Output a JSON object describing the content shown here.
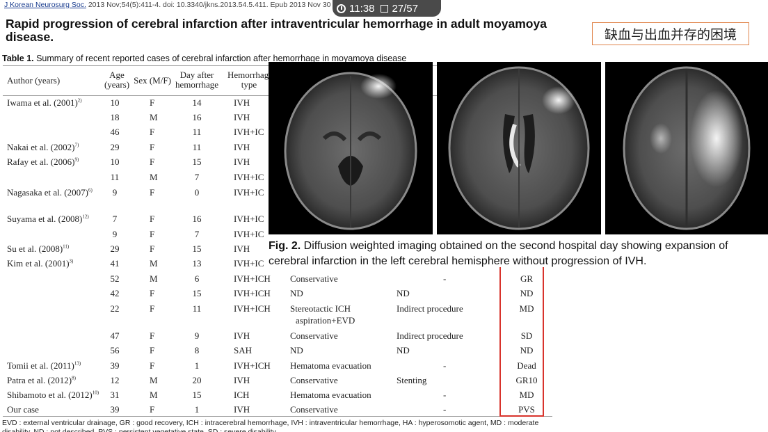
{
  "citation": {
    "journal": "J Korean Neurosurg Soc.",
    "rest": " 2013 Nov;54(5):411-4. doi: 10.3340/jkns.2013.54.5.411. Epub 2013 Nov 30"
  },
  "overlay": {
    "time": "11:38",
    "page": "27/57"
  },
  "title": "Rapid progression of cerebral infarction after intraventricular hemorrhage in adult moyamoya disease.",
  "note": "缺血与出血并存的困境",
  "table": {
    "caption_label": "Table 1.",
    "caption_text": " Summary of recent reported cases of cerebral infarction after hemorrhage in moyamoya disease",
    "headers": {
      "author": "Author (years)",
      "age": "Age\n(years)",
      "sex": "Sex (M/F)",
      "day": "Day after\nhemorrhage",
      "hemorrhage": "Hemorrhage\ntype"
    },
    "rows": [
      {
        "author": "Iwama et al. (2001)",
        "ref": "2)",
        "age": "10",
        "sex": "F",
        "day": "14",
        "type": "IVH",
        "treat": "",
        "surg": "",
        "out": ""
      },
      {
        "author": "",
        "ref": "",
        "age": "18",
        "sex": "M",
        "day": "16",
        "type": "IVH",
        "treat": "",
        "surg": "",
        "out": ""
      },
      {
        "author": "",
        "ref": "",
        "age": "46",
        "sex": "F",
        "day": "11",
        "type": "IVH+IC",
        "treat": "",
        "surg": "",
        "out": ""
      },
      {
        "author": "Nakai et al. (2002)",
        "ref": "7)",
        "age": "29",
        "sex": "F",
        "day": "11",
        "type": "IVH",
        "treat": "",
        "surg": "",
        "out": ""
      },
      {
        "author": "Rafay et al. (2006)",
        "ref": "9)",
        "age": "10",
        "sex": "F",
        "day": "15",
        "type": "IVH",
        "treat": "",
        "surg": "",
        "out": ""
      },
      {
        "author": "",
        "ref": "",
        "age": "11",
        "sex": "M",
        "day": "7",
        "type": "IVH+IC",
        "treat": "",
        "surg": "",
        "out": ""
      },
      {
        "author": "Nagasaka et al. (2007)",
        "ref": "6)",
        "age": "9",
        "sex": "F",
        "day": "0",
        "type": "IVH+IC",
        "treat": "",
        "surg": "",
        "out": ""
      },
      {
        "author": "Suyama et al. (2008)",
        "ref": "12)",
        "age": "7",
        "sex": "F",
        "day": "16",
        "type": "IVH+IC",
        "treat": "",
        "surg": "",
        "out": ""
      },
      {
        "author": "",
        "ref": "",
        "age": "9",
        "sex": "F",
        "day": "7",
        "type": "IVH+IC",
        "treat": "",
        "surg": "",
        "out": ""
      },
      {
        "author": "Su et al. (2008)",
        "ref": "11)",
        "age": "29",
        "sex": "F",
        "day": "15",
        "type": "IVH",
        "treat": "",
        "surg": "",
        "out": ""
      },
      {
        "author": "Kim et al. (2001)",
        "ref": "3)",
        "age": "41",
        "sex": "M",
        "day": "13",
        "type": "IVH+IC",
        "treat": "",
        "surg": "",
        "out": ""
      },
      {
        "author": "",
        "ref": "",
        "age": "52",
        "sex": "M",
        "day": "6",
        "type": "IVH+ICH",
        "treat": "Conservative",
        "surg": "-",
        "out": "GR"
      },
      {
        "author": "",
        "ref": "",
        "age": "42",
        "sex": "F",
        "day": "15",
        "type": "IVH+ICH",
        "treat": "ND",
        "surg": "ND",
        "out": "ND"
      },
      {
        "author": "",
        "ref": "",
        "age": "22",
        "sex": "F",
        "day": "11",
        "type": "IVH+ICH",
        "treat": "Stereotactic ICH",
        "treat2": "aspiration+EVD",
        "surg": "Indirect procedure",
        "out": "MD"
      },
      {
        "author": "",
        "ref": "",
        "age": "47",
        "sex": "F",
        "day": "9",
        "type": "IVH",
        "treat": "Conservative",
        "surg": "Indirect procedure",
        "out": "SD"
      },
      {
        "author": "",
        "ref": "",
        "age": "56",
        "sex": "F",
        "day": "8",
        "type": "SAH",
        "treat": "ND",
        "surg": "ND",
        "out": "ND"
      },
      {
        "author": "Tomii et al. (2011)",
        "ref": "13)",
        "age": "39",
        "sex": "F",
        "day": "1",
        "type": "IVH+ICH",
        "treat": "Hematoma evacuation",
        "surg": "-",
        "out": "Dead"
      },
      {
        "author": "Patra et al. (2012)",
        "ref": "8)",
        "age": "12",
        "sex": "M",
        "day": "20",
        "type": "IVH",
        "treat": "Conservative",
        "surg": "Stenting",
        "out": "GR10"
      },
      {
        "author": "Shibamoto et al. (2012)",
        "ref": "10)",
        "age": "31",
        "sex": "M",
        "day": "15",
        "type": "ICH",
        "treat": "Hematoma evacuation",
        "surg": "-",
        "out": "MD"
      },
      {
        "author": "Our case",
        "ref": "",
        "age": "39",
        "sex": "F",
        "day": "1",
        "type": "IVH",
        "treat": "Conservative",
        "surg": "-",
        "out": "PVS"
      }
    ]
  },
  "figure": {
    "label": "Fig. 2.",
    "caption": " Diffusion weighted imaging obtained on the second hospital day showing expansion of cerebral infarction in the left cerebral hemisphere without progression of IVH.",
    "images": [
      "mri-slice-basal-ganglia",
      "mri-slice-ventricles",
      "mri-slice-centrum-semiovale"
    ]
  },
  "footnote": "EVD : external ventricular drainage, GR : good recovery, ICH : intracerebral hemorrhage, IVH : intraventricular hemorrhage, HA : hyperosomotic agent, MD : moderate",
  "footnote2": "disability, ND : not described, PVS : persistent vegetative state, SD : severe disability"
}
